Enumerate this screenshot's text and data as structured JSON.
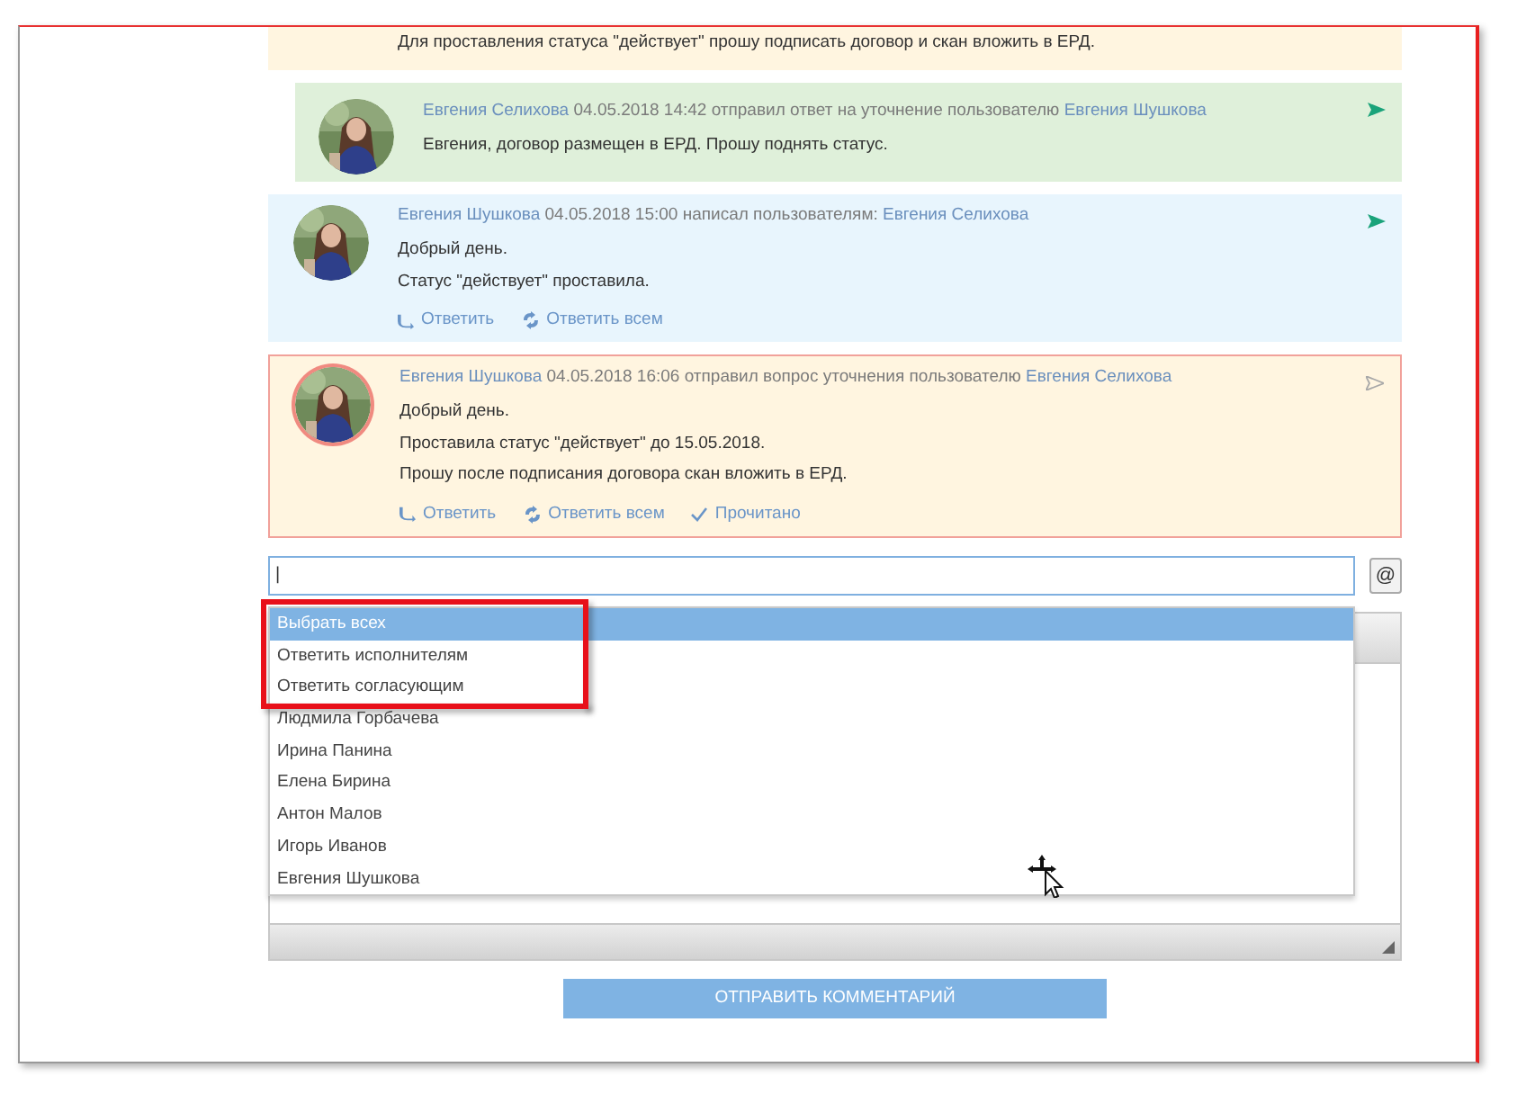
{
  "messages": [
    {
      "kind": "partial",
      "lines": [
        "Для проставления статуса \"действует\" прошу подписать договор и скан вложить в ЕРД."
      ]
    },
    {
      "kind": "reply",
      "author": "Евгения Селихова",
      "meta": "04.05.2018 14:42 отправил ответ на уточнение пользователю",
      "recipient": "Евгения Шушкова",
      "delivered": true,
      "highlighted": false,
      "lines": [
        "Евгения, договор размещен в ЕРД. Прошу поднять статус."
      ]
    },
    {
      "kind": "message",
      "author": "Евгения Шушкова",
      "meta": "04.05.2018 15:00 написал пользователям:",
      "recipient": "Евгения Селихова",
      "delivered": true,
      "highlighted": false,
      "lines": [
        "Добрый день.",
        "Статус \"действует\" проставила."
      ],
      "actions": [
        {
          "kind": "reply",
          "label": "Ответить"
        },
        {
          "kind": "reply_all",
          "label": "Ответить всем"
        }
      ]
    },
    {
      "kind": "message",
      "author": "Евгения Шушкова",
      "meta": "04.05.2018 16:06 отправил вопрос уточнения пользователю",
      "recipient": "Евгения Селихова",
      "delivered": false,
      "highlighted": true,
      "lines": [
        "Добрый день.",
        "Проставила статус \"действует\" до 15.05.2018.",
        "Прошу после подписания договора скан вложить в ЕРД."
      ],
      "actions": [
        {
          "kind": "reply",
          "label": "Ответить"
        },
        {
          "kind": "reply_all",
          "label": "Ответить всем"
        },
        {
          "kind": "read",
          "label": "Прочитано"
        }
      ]
    }
  ],
  "recipient_field": {
    "value": "|",
    "mention_button": "@"
  },
  "dropdown": [
    {
      "label": "Выбрать всех",
      "selected": true
    },
    {
      "label": "Ответить исполнителям",
      "selected": false
    },
    {
      "label": "Ответить согласующим",
      "selected": false
    },
    {
      "label": "Людмила Горбачева",
      "selected": false
    },
    {
      "label": "Ирина Панина",
      "selected": false
    },
    {
      "label": "Елена Бирина",
      "selected": false
    },
    {
      "label": "Антон Малов",
      "selected": false
    },
    {
      "label": "Игорь Иванов",
      "selected": false
    },
    {
      "label": "Евгения Шушкова",
      "selected": false
    }
  ],
  "submit_button": "ОТПРАВИТЬ КОММЕНТАРИЙ"
}
